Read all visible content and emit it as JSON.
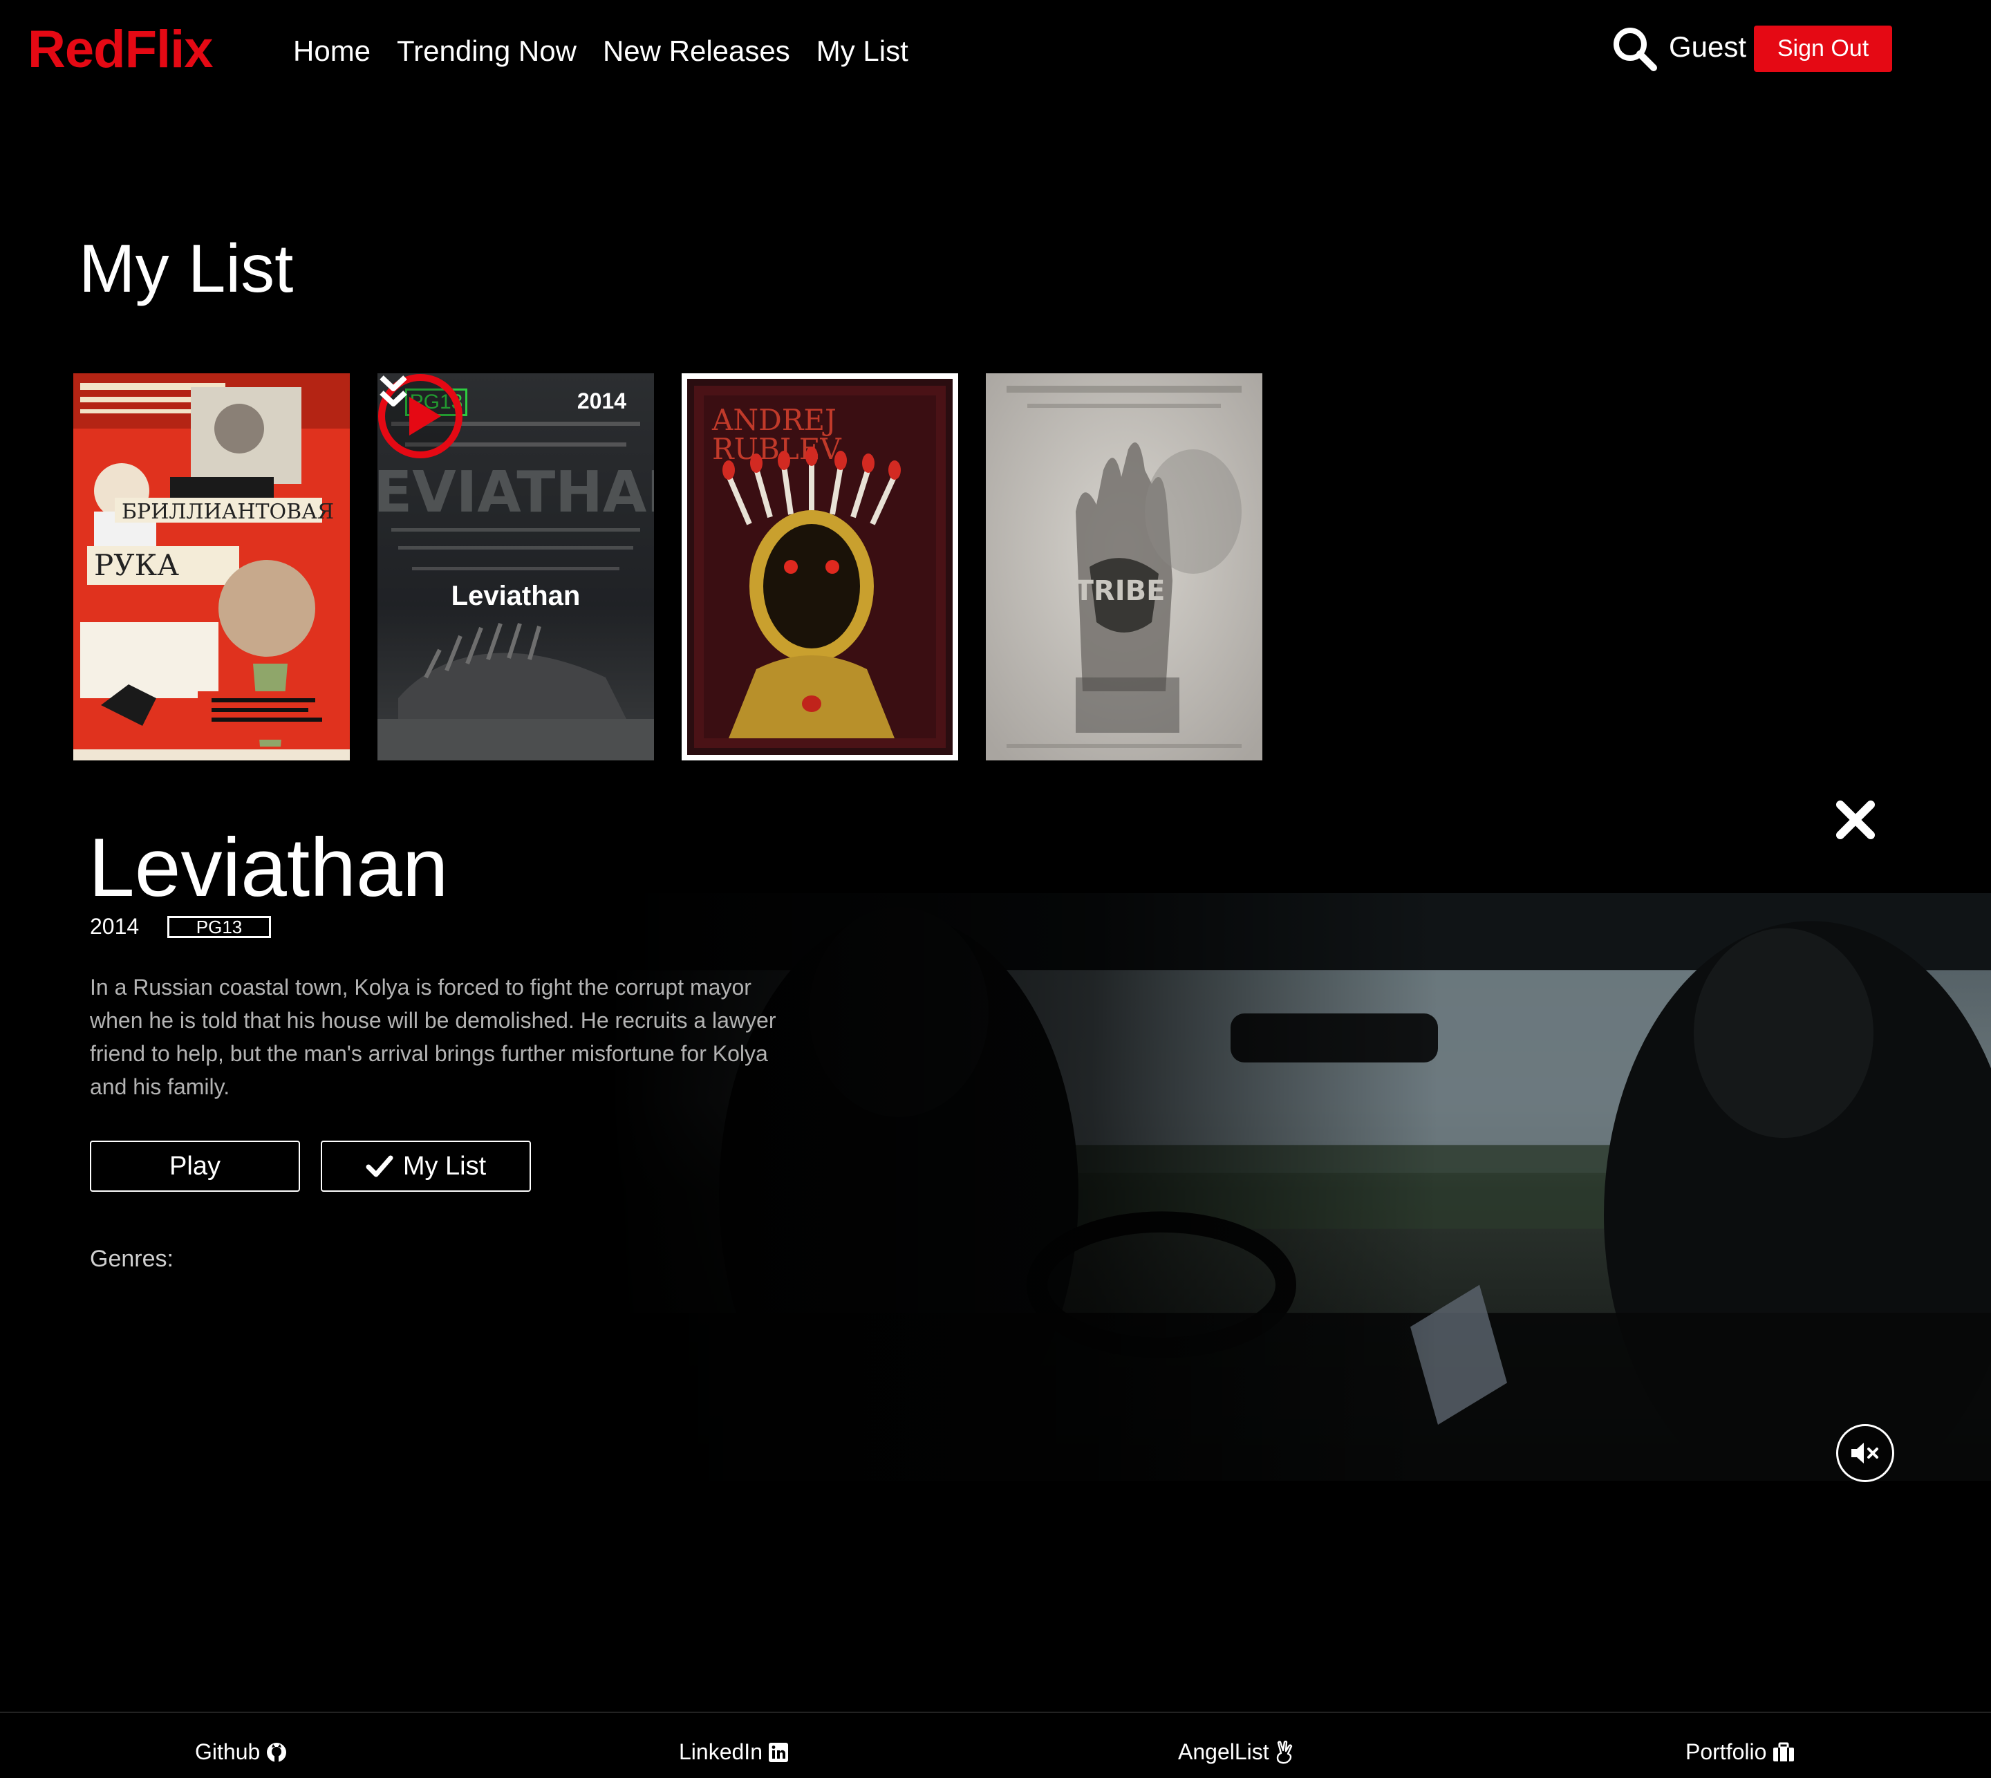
{
  "nav": {
    "logo": "RedFlix",
    "links": [
      "Home",
      "Trending Now",
      "New Releases",
      "My List"
    ],
    "user": "Guest",
    "sign_out": "Sign Out"
  },
  "my_list": {
    "title": "My List",
    "hover_card": {
      "rating": "PG13",
      "year": "2014",
      "title": "Leviathan"
    }
  },
  "detail": {
    "title": "Leviathan",
    "year": "2014",
    "rating": "PG13",
    "description": "In a Russian coastal town, Kolya is forced to fight the corrupt mayor when he is told that his house will be demolished. He recruits a lawyer friend to help, but the man's arrival brings further misfortune for Kolya and his family.",
    "play_label": "Play",
    "mylist_label": "My List",
    "genres_label": "Genres:"
  },
  "footer": {
    "links": [
      "Github",
      "LinkedIn",
      "AngelList",
      "Portfolio"
    ]
  },
  "colors": {
    "brand": "#e50914",
    "rating_green": "#2ecc40",
    "background": "#000000"
  }
}
